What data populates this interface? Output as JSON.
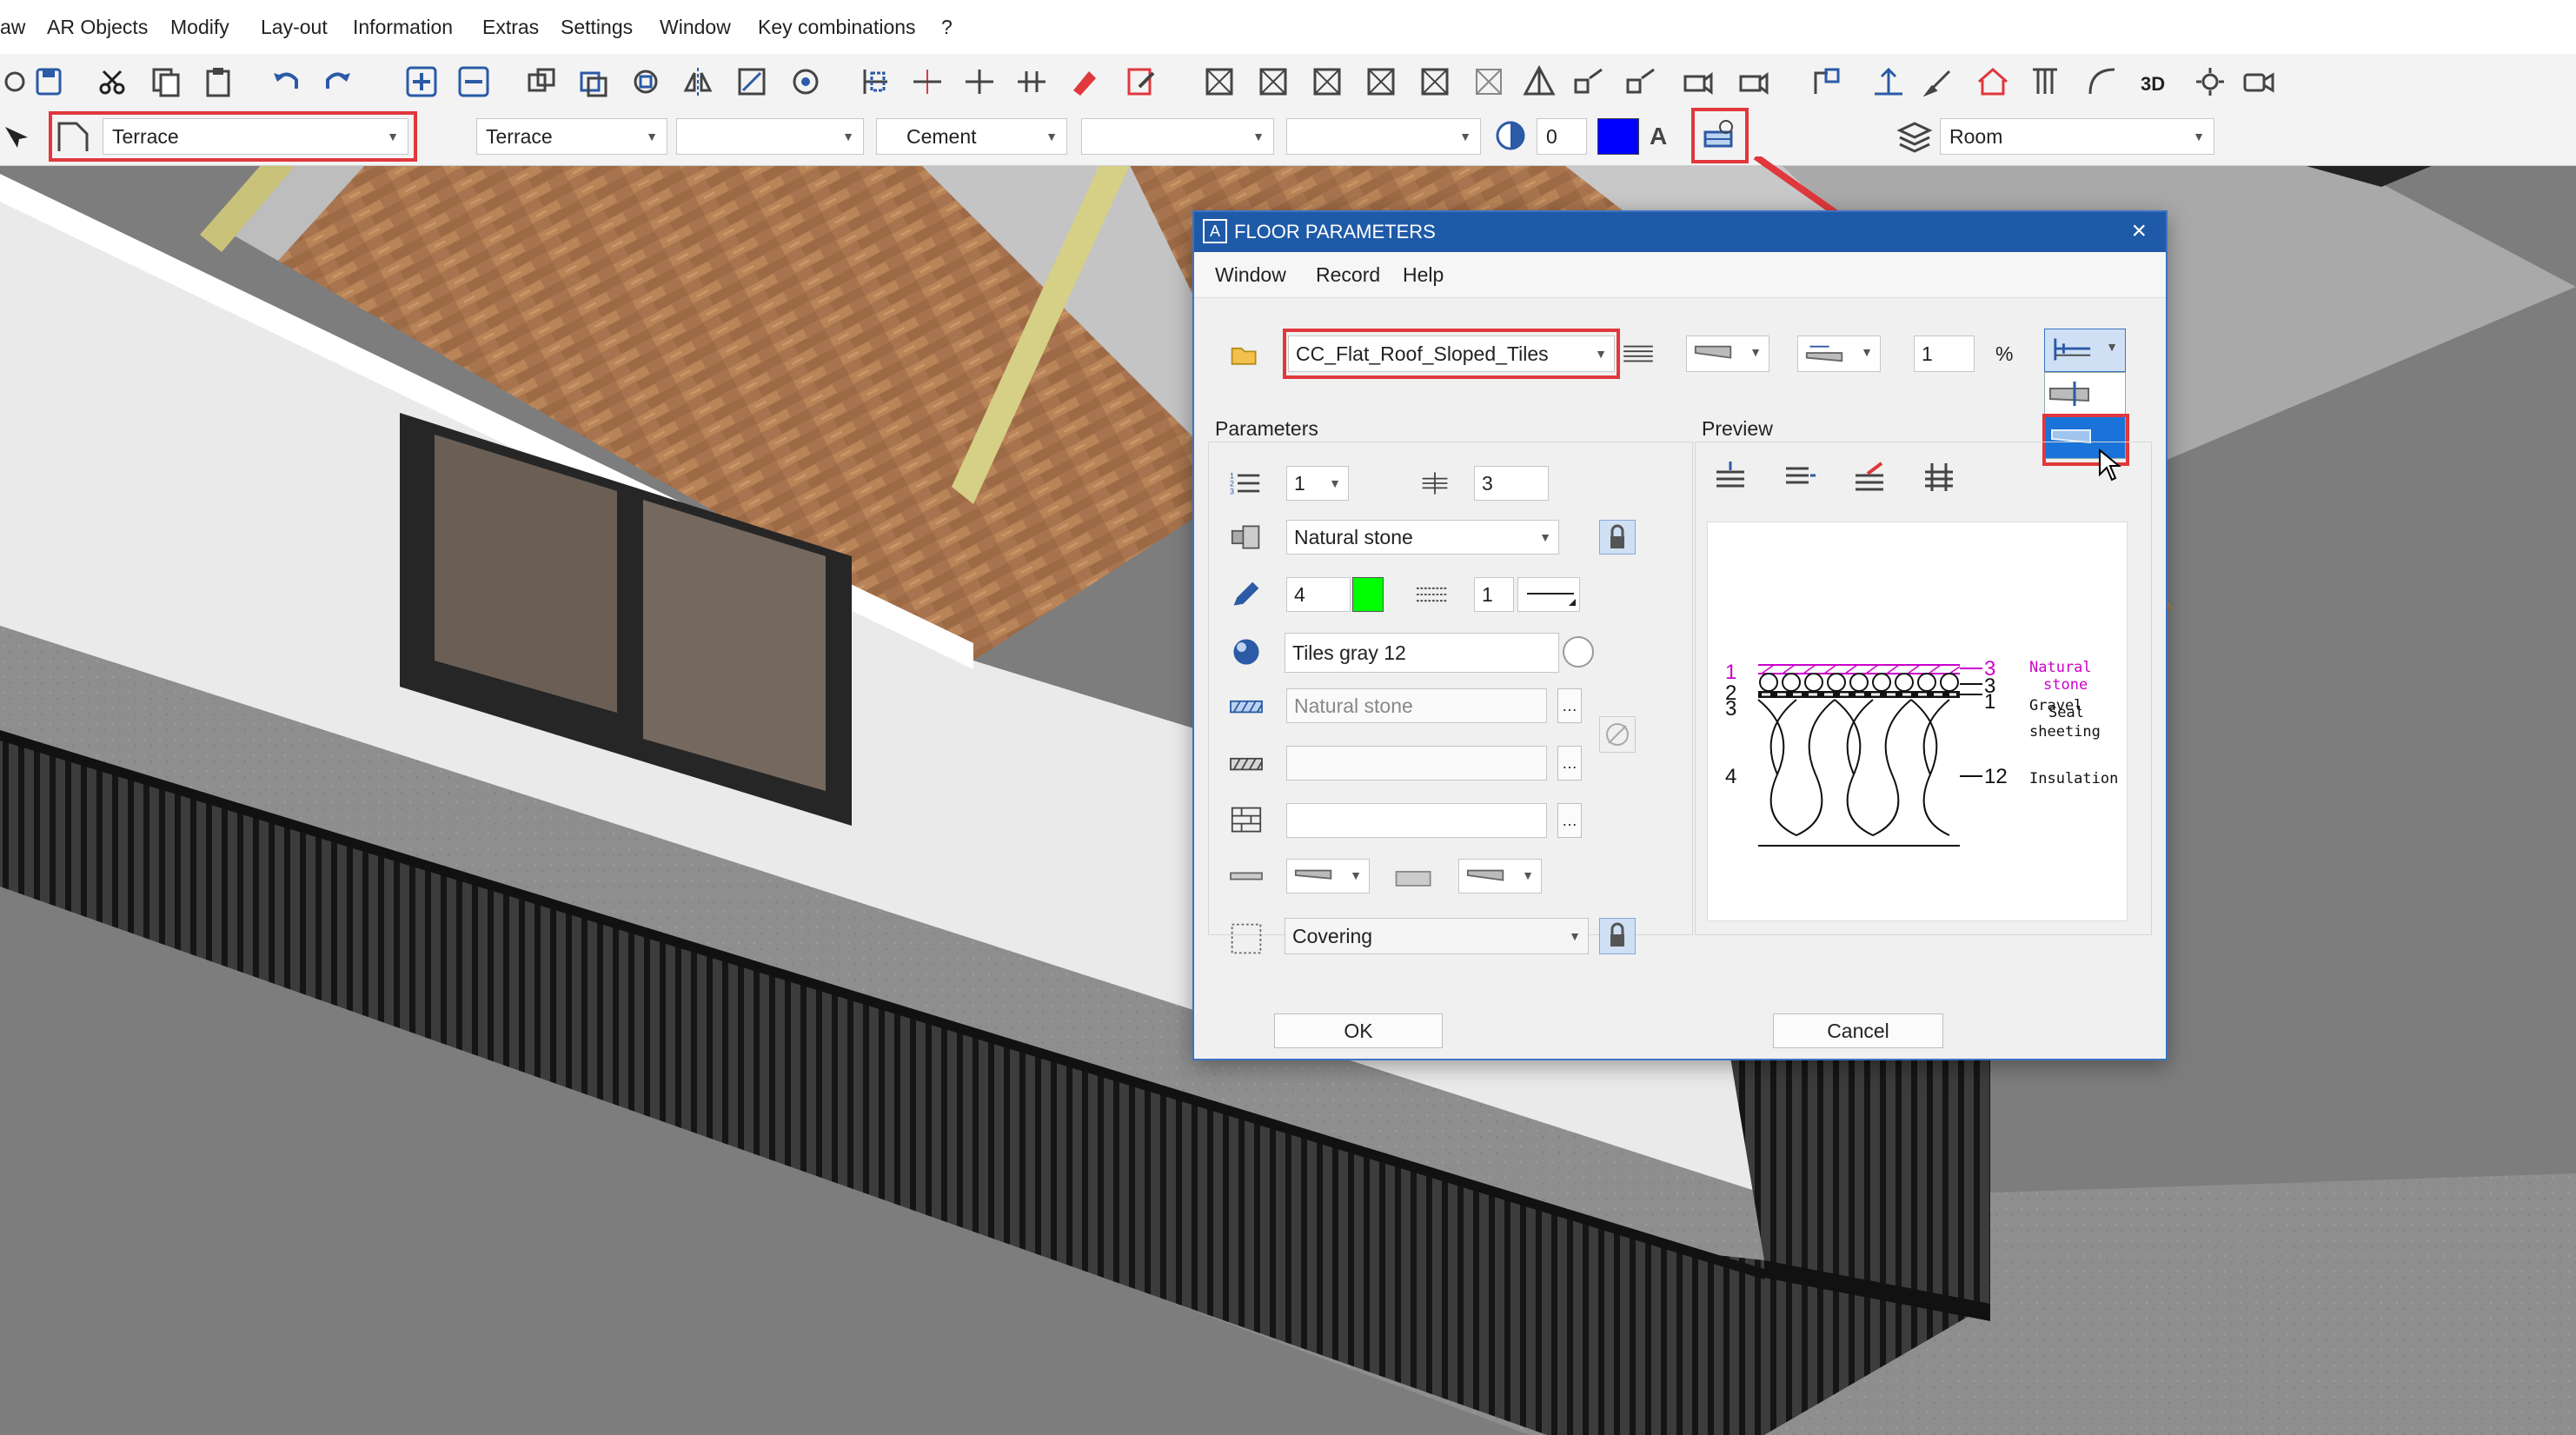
{
  "menu": {
    "items": [
      "aw",
      "AR Objects",
      "Modify",
      "Lay-out",
      "Information",
      "Extras",
      "Settings",
      "Window",
      "Key combinations",
      "?"
    ]
  },
  "properties_bar": {
    "floor_type": "Terrace",
    "layer_name": "Terrace",
    "pattern": "",
    "material": "Cement",
    "linetype": "",
    "linestyle": "",
    "pen_value": "0",
    "pen_color": "#0000ff",
    "room_label": "Room"
  },
  "dialog": {
    "title": "FLOOR PARAMETERS",
    "menu": [
      "Window",
      "Record",
      "Help"
    ],
    "record_name": "CC_Flat_Roof_Sloped_Tiles",
    "slope_value": "1",
    "slope_unit": "%",
    "sections": {
      "parameters": "Parameters",
      "preview": "Preview"
    },
    "layer_number": "1",
    "layer_count": "3",
    "material": "Natural stone",
    "pen": "4",
    "pen_color": "#00ff00",
    "line_weight": "1",
    "texture": "Tiles gray 12",
    "hatch_name": "Natural stone",
    "pattern2": "",
    "masonry": "",
    "covering": "Covering",
    "ok_label": "OK",
    "cancel_label": "Cancel",
    "preview": {
      "left_numbers": [
        "1",
        "2",
        "3",
        "4"
      ],
      "right_numbers": [
        "3",
        "3",
        "1",
        "12"
      ],
      "layer_names": [
        "Natural",
        "stone",
        "Gravel",
        "Seal",
        "sheeting",
        "Insulation"
      ],
      "accent_color": "#cc00cc"
    }
  },
  "colors": {
    "highlight_red": "#e0383c",
    "dialog_title_bg": "#1f5aa8",
    "selection_blue": "#1a73d9"
  }
}
